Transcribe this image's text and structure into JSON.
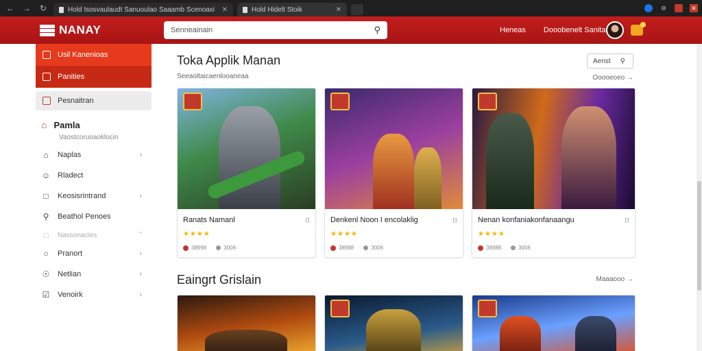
{
  "browser": {
    "tabs": [
      {
        "title": "Hold Isosvaulaudt Sanuoulao Saaamb Scenoaxi"
      },
      {
        "title": "Hold Hidelt Stoik"
      }
    ]
  },
  "header": {
    "logo_text": "NANAY",
    "search_placeholder": "Senneainain",
    "links": [
      "Heneas",
      "Dooobenelt Sanitan"
    ]
  },
  "sidebar": {
    "hero_items": [
      {
        "label": "Usil Kanenioas",
        "icon": "square-icon"
      },
      {
        "label": "Panities",
        "icon": "square-icon"
      }
    ],
    "selected": {
      "label": "Pesnaitran",
      "icon": "square-icon"
    },
    "home": {
      "label": "Pamla",
      "sub": "Vaostcoruoaoklocin"
    },
    "items": [
      {
        "label": "Naplas",
        "icon": "home-outline-icon",
        "chevron": true
      },
      {
        "label": "Rladect",
        "icon": "face-icon",
        "chevron": false
      },
      {
        "label": "Keosisrintrand",
        "icon": "square-icon",
        "chevron": true
      },
      {
        "label": "Beathol Penoes",
        "icon": "search-icon",
        "chevron": false
      },
      {
        "label": "Nassonacies",
        "icon": "square-icon",
        "chevron": true,
        "dim": true
      },
      {
        "label": "Pranort",
        "icon": "chat-icon",
        "chevron": true
      },
      {
        "label": "Netlian",
        "icon": "info-icon",
        "chevron": true
      },
      {
        "label": "Venoirk",
        "icon": "check-box-icon",
        "chevron": true
      }
    ]
  },
  "section1": {
    "title": "Toka Applik Manan",
    "subtitle": "Seeaoltaicaenlooaneaa",
    "filter_label": "Aenst",
    "see_more": "Ooooeoeo",
    "cards": [
      {
        "name": "Ranats Namanl",
        "stars": "★★★★",
        "downloads": "38998",
        "size": "3006"
      },
      {
        "name": "Denkenl Noon I encolaklig",
        "stars": "★★★★",
        "downloads": "38988",
        "size": "3006"
      },
      {
        "name": "Nenan konfaniakonfanaangu",
        "stars": "★★★★",
        "downloads": "38988",
        "size": "3006"
      }
    ]
  },
  "section2": {
    "title": "Eaingrt Grislain",
    "see_more": "Maaaooo"
  }
}
